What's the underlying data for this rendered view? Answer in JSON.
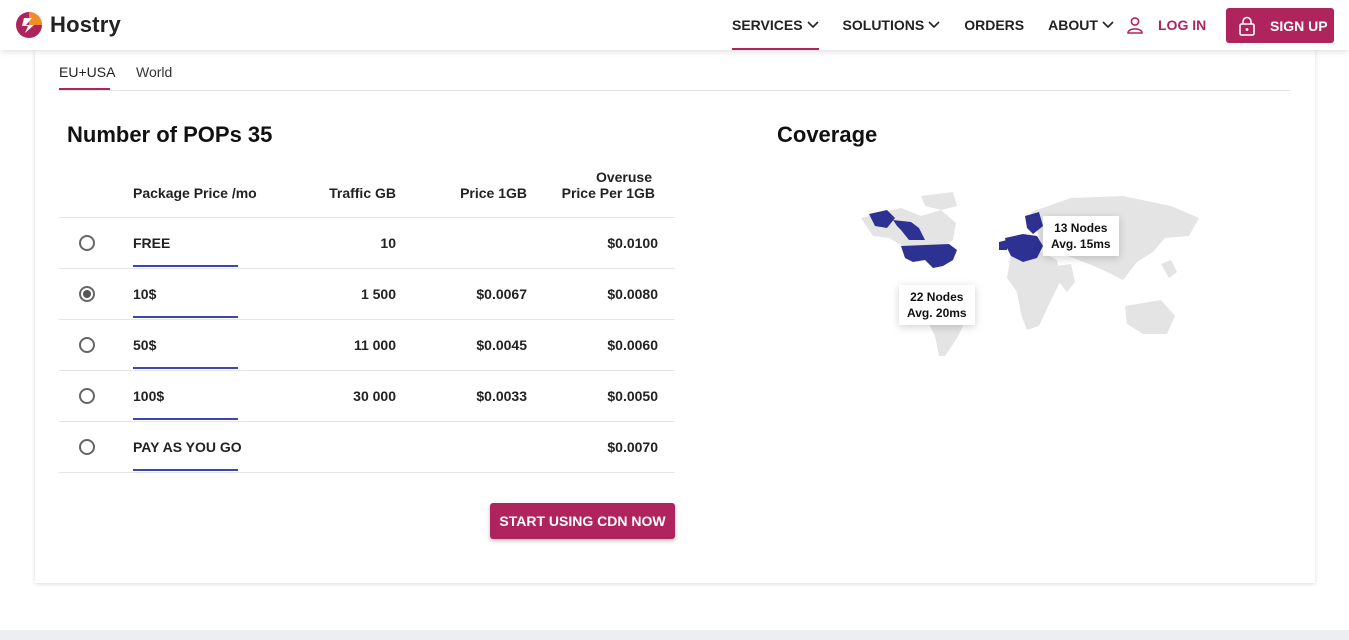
{
  "brand": {
    "name": "Hostry"
  },
  "nav": {
    "items": [
      {
        "label": "SERVICES",
        "has_menu": true,
        "active": true
      },
      {
        "label": "SOLUTIONS",
        "has_menu": true
      },
      {
        "label": "ORDERS",
        "has_menu": false
      },
      {
        "label": "ABOUT",
        "has_menu": true
      }
    ],
    "login": "LOG IN",
    "signup": "SIGN UP"
  },
  "tabs": [
    "EU+USA",
    "World"
  ],
  "pricing": {
    "title": "Number of POPs 35",
    "columns": {
      "package": "Package Price /mo",
      "traffic": "Traffic GB",
      "price": "Price 1GB",
      "overuse_1": "Overuse",
      "overuse_2": "Price Per 1GB"
    },
    "rows": [
      {
        "package": "FREE",
        "traffic": "10",
        "price": "",
        "overuse": "$0.0100",
        "selected": false
      },
      {
        "package": "10$",
        "traffic": "1 500",
        "price": "$0.0067",
        "overuse": "$0.0080",
        "selected": true
      },
      {
        "package": "50$",
        "traffic": "11 000",
        "price": "$0.0045",
        "overuse": "$0.0060",
        "selected": false
      },
      {
        "package": "100$",
        "traffic": "30 000",
        "price": "$0.0033",
        "overuse": "$0.0050",
        "selected": false
      },
      {
        "package": "PAY AS YOU GO",
        "traffic": "",
        "price": "",
        "overuse": "$0.0070",
        "selected": false
      }
    ],
    "cta": "START USING CDN NOW"
  },
  "coverage": {
    "title": "Coverage",
    "eu": {
      "line1": "13 Nodes",
      "line2": "Avg. 15ms"
    },
    "us": {
      "line1": "22 Nodes",
      "line2": "Avg. 20ms"
    }
  },
  "colors": {
    "accent": "#b0245e",
    "selection": "#3949ab",
    "map_highlight": "#2d3192",
    "map_base": "#e4e4e4"
  }
}
